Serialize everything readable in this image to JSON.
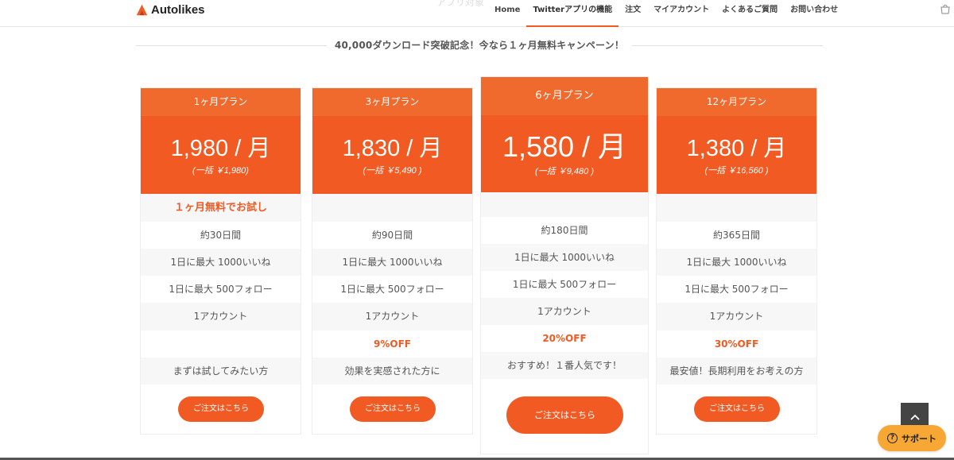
{
  "header": {
    "logo_text": "Autolikes",
    "ghost_text": "アプリ対象",
    "nav": [
      {
        "label": "Home"
      },
      {
        "label": "Twitterアプリの機能"
      },
      {
        "label": "注文"
      },
      {
        "label": "マイアカウント"
      },
      {
        "label": "よくあるご質問"
      },
      {
        "label": "お問い合わせ"
      }
    ],
    "active_nav": "Twitterアプリの機能"
  },
  "banner": {
    "text": "40,000ダウンロード突破記念！今なら１ヶ月無料キャンペーン！"
  },
  "plans": [
    {
      "name": "1ヶ月プラン",
      "price": "1,980 / 月",
      "total": "(一括 ￥1,980)",
      "promo": "１ヶ月無料でお試し",
      "duration": "約30日間",
      "likes": "1日に最大 1000いいね",
      "follows": "1日に最大 500フォロー",
      "accounts": "1アカウント",
      "discount": "",
      "target": "まずは試してみたい方",
      "button": "ご注文はこちら"
    },
    {
      "name": "3ヶ月プラン",
      "price": "1,830 / 月",
      "total": "(一括 ￥5,490 )",
      "promo": "",
      "duration": "約90日間",
      "likes": "1日に最大 1000いいね",
      "follows": "1日に最大 500フォロー",
      "accounts": "1アカウント",
      "discount": "9%OFF",
      "target": "効果を実感された方に",
      "button": "ご注文はこちら"
    },
    {
      "name": "6ヶ月プラン",
      "price": "1,580 / 月",
      "total": "(一括 ￥9,480 )",
      "promo": "",
      "duration": "約180日間",
      "likes": "1日に最大 1000いいね",
      "follows": "1日に最大 500フォロー",
      "accounts": "1アカウント",
      "discount": "20%OFF",
      "target": "おすすめ！１番人気です！",
      "button": "ご注文はこちら",
      "featured": true
    },
    {
      "name": "12ヶ月プラン",
      "price": "1,380 / 月",
      "total": "(一括 ￥16,560 )",
      "promo": "",
      "duration": "約365日間",
      "likes": "1日に最大 1000いいね",
      "follows": "1日に最大 500フォロー",
      "accounts": "1アカウント",
      "discount": "30%OFF",
      "target": "最安値！長期利用をお考えの方",
      "button": "ご注文はこちら"
    }
  ],
  "floating": {
    "support_label": "サポート"
  },
  "colors": {
    "accent": "#f15a22",
    "header_orange": "#f06a2e",
    "support": "#f7a733",
    "to_top": "#444444"
  }
}
